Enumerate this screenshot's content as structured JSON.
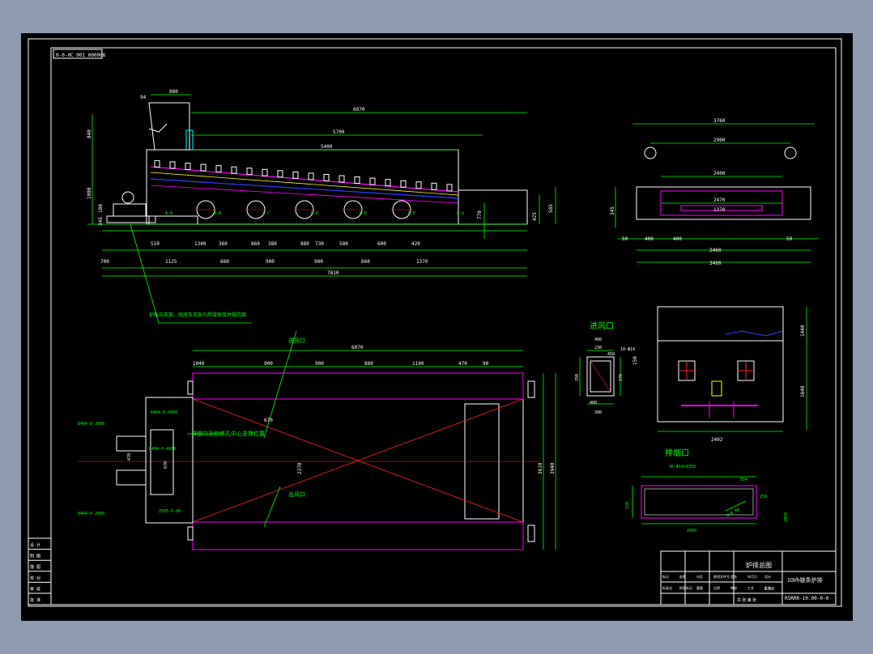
{
  "colors": {
    "background": "#8e9bb1",
    "canvas": "#000000",
    "frame": "#ffffff",
    "dimension": "#00ff00",
    "outline": "#ffffff",
    "accent": "#ff00ff",
    "axis": "#ff2020",
    "cyan": "#00ffff",
    "blue": "#3040ff",
    "yellow": "#ffff00"
  },
  "header_label": "0-0-0C 001 000006",
  "side_view": {
    "dims_top": [
      "880",
      "6070",
      "5700",
      "5400",
      "94"
    ],
    "dims_left": [
      "840",
      "1080",
      "180",
      "345"
    ],
    "dims_right": [
      "770",
      "425",
      "585"
    ],
    "dims_row1": [
      "510",
      "1340",
      "360",
      "860",
      "380",
      "880",
      "730",
      "580",
      "600",
      "420"
    ],
    "dims_row2": [
      "700",
      "1125",
      "660",
      "900",
      "900",
      "660",
      "1370"
    ],
    "dims_total": "7810",
    "tags": [
      "A-A",
      "B-B",
      "C-C",
      "D-D",
      "E-E",
      "F-F",
      "G-G"
    ],
    "note": "护板与支架、底座及支架均焊接联接并做防腐"
  },
  "end_view": {
    "dims": [
      "3760",
      "2900",
      "2400",
      "2470",
      "1370",
      "345",
      "50",
      "400",
      "400",
      "50",
      "2460",
      "3460"
    ]
  },
  "plan_view": {
    "dims_top": [
      "6070",
      "1040",
      "900",
      "900",
      "880",
      "1100",
      "470",
      "90"
    ],
    "dims_right": [
      "3610",
      "3940"
    ],
    "dims_mid": [
      "2370",
      "670"
    ],
    "labels": [
      "进风口",
      "出风口",
      "排烟口及检修孔中心支撑位置"
    ],
    "callouts": [
      "8404-0-2000",
      "6404-0-4900",
      "B404-0-4900",
      "8404-0-2000",
      "2505-0-00"
    ],
    "small_dims": [
      "470",
      "670"
    ]
  },
  "section_view": {
    "dims": [
      "1440",
      "2402",
      "1640",
      "150"
    ]
  },
  "inlet_detail": {
    "title": "进风口",
    "dims": [
      "230",
      "400",
      "250",
      "270",
      "300",
      "480",
      "450",
      "10-Φ14"
    ]
  },
  "outlet_detail": {
    "title": "排烟口",
    "dims": [
      "36-Φ14×8350",
      "554",
      "250",
      "2060",
      "150",
      "4×8 00",
      "2090"
    ]
  },
  "left_table": {
    "rows": [
      "设 计",
      "制 图",
      "描 图",
      "校 对",
      "审 核",
      "批 准"
    ]
  },
  "title_block": {
    "part_name": "炉排总图",
    "product": "10t/h链条炉排",
    "drawing_no": "RSRRR-10.00-0-0",
    "scale": "1:50",
    "sheet": "共  张  第  张",
    "cells": [
      "标记",
      "处数",
      "分区",
      "更改文件号",
      "签名",
      "年月日",
      "设计",
      "标准化",
      "阶段标记",
      "重量",
      "比例",
      "审核",
      "工艺",
      "批准"
    ]
  }
}
